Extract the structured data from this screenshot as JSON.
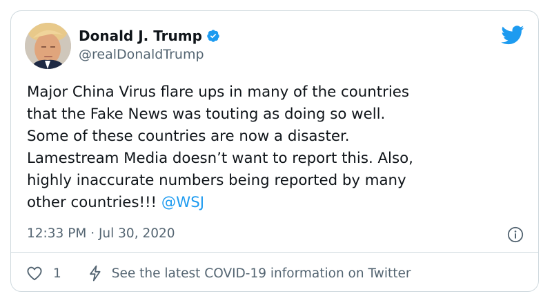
{
  "user": {
    "display_name": "Donald J. Trump",
    "handle": "@realDonaldTrump",
    "verified": true
  },
  "tweet": {
    "lines": [
      "Major China Virus flare ups in many of the countries",
      "that the Fake News was touting as doing so well.",
      "Some of these countries are now a disaster.",
      "Lamestream Media doesn’t want to report this. Also,",
      "highly inaccurate numbers being reported by many",
      "other countries!!! "
    ],
    "mention": "@WSJ",
    "timestamp": "12:33 PM · Jul 30, 2020"
  },
  "actions": {
    "like_count": "1",
    "covid_label": "See the latest COVID-19 information on Twitter"
  },
  "icons": {
    "brand": "twitter-bird-icon",
    "verified": "verified-badge-icon",
    "info": "info-icon",
    "like": "heart-icon",
    "covid": "bolt-icon"
  },
  "colors": {
    "accent": "#1d9bf0",
    "text": "#0f1419",
    "secondary": "#536471",
    "border": "#cfd9de"
  }
}
